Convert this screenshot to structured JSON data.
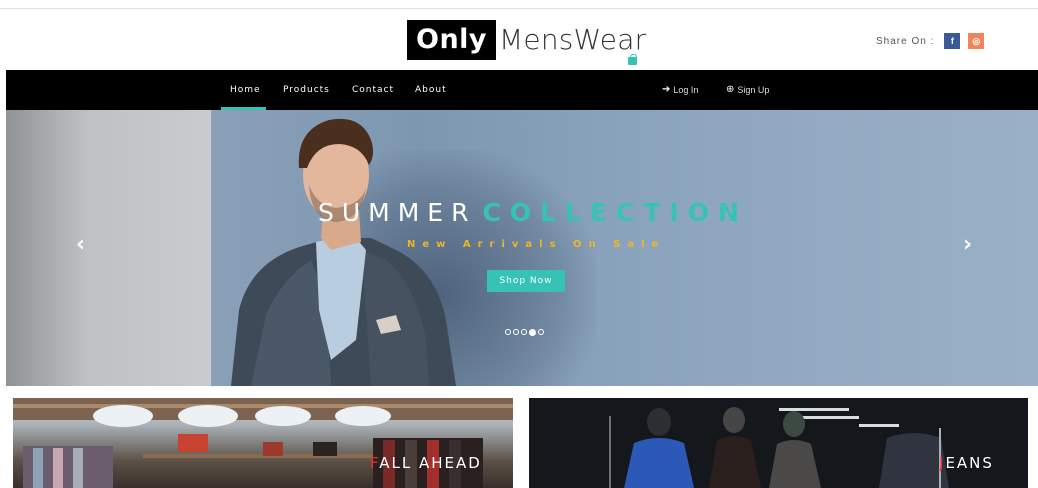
{
  "brand": {
    "logo_box": "Only",
    "logo_rest": "MensWear"
  },
  "share": {
    "label": "Share On :",
    "facebook": "f",
    "instagram": "◎"
  },
  "nav": {
    "items": [
      {
        "label": "Home",
        "active": true
      },
      {
        "label": "Products",
        "active": false
      },
      {
        "label": "Contact",
        "active": false
      },
      {
        "label": "About",
        "active": false
      }
    ],
    "login_label": "Log In",
    "signup_label": "Sign Up"
  },
  "hero": {
    "title_plain": "SUMMER",
    "title_accent": "COLLECTION",
    "subtitle": "New Arrivals On Sale",
    "button_label": "Shop Now",
    "slides_total": 5,
    "active_slide": 4,
    "prev_icon": "chevron-left-icon",
    "next_icon": "chevron-right-icon"
  },
  "tiles": [
    {
      "first_letter": "F",
      "rest": "ALL AHEAD"
    },
    {
      "first_letter": "J",
      "rest": "EANS"
    }
  ],
  "colors": {
    "accent": "#37c3b3",
    "subtitle": "#f0b428",
    "nav_bg": "#000000",
    "facebook": "#3b5998",
    "instagram": "#f2845b"
  }
}
